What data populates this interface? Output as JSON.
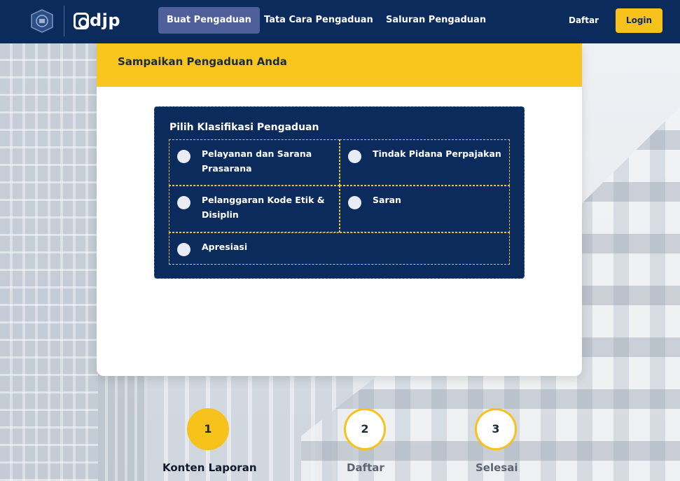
{
  "header": {
    "logo_text": "djp",
    "nav": [
      {
        "label": "Buat Pengaduan",
        "active": true
      },
      {
        "label": "Tata Cara Pengaduan",
        "active": false
      },
      {
        "label": "Saluran Pengaduan",
        "active": false
      }
    ],
    "daftar_label": "Daftar",
    "login_label": "Login"
  },
  "card": {
    "title": "Sampaikan Pengaduan Anda",
    "klasifikasi": {
      "heading": "Pilih Klasifikasi Pengaduan",
      "options": [
        {
          "label": "Pelayanan dan Sarana Prasarana",
          "selected": false
        },
        {
          "label": "Tindak Pidana Perpajakan",
          "selected": false
        },
        {
          "label": "Pelanggaran Kode Etik & Disiplin",
          "selected": false
        },
        {
          "label": "Saran",
          "selected": false
        },
        {
          "label": "Apresiasi",
          "selected": false
        }
      ]
    }
  },
  "steps": [
    {
      "number": "1",
      "label": "Konten Laporan",
      "active": true
    },
    {
      "number": "2",
      "label": "Daftar",
      "active": false
    },
    {
      "number": "3",
      "label": "Selesai",
      "active": false
    }
  ],
  "colors": {
    "navy": "#0c2b5d",
    "accent_yellow": "#f7c21c",
    "nav_active": "#4e5f9a"
  },
  "icons": {
    "emblem": "kemenkeu-emblem-icon",
    "logo": "djp-logo-icon",
    "radio": "radio-icon"
  }
}
